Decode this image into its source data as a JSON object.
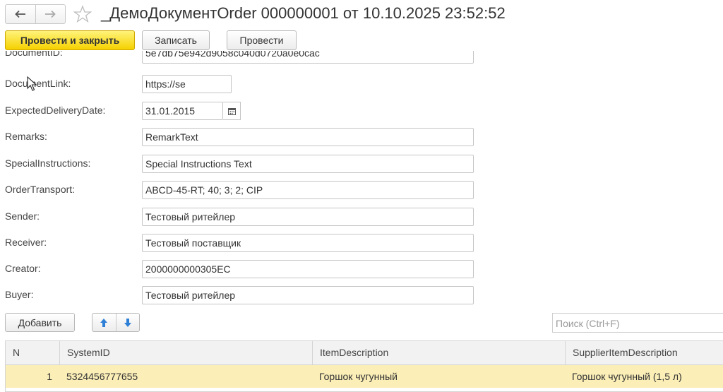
{
  "window": {
    "title": "_ДемоДокументOrder 000000001 от 10.10.2025 23:52:52"
  },
  "toolbar": {
    "post_close_label": "Провести и закрыть",
    "save_label": "Записать",
    "post_label": "Провести"
  },
  "fields": [
    {
      "label": "DocumentID:",
      "value": "5e7db75e942d9058c040d0720a0e0cac"
    },
    {
      "label": "DocumentLink:",
      "value": "https://se"
    },
    {
      "label": "ExpectedDeliveryDate:",
      "value": "31.01.2015"
    },
    {
      "label": "Remarks:",
      "value": "RemarkText"
    },
    {
      "label": "SpecialInstructions:",
      "value": "Special Instructions Text"
    },
    {
      "label": "OrderTransport:",
      "value": "ABCD-45-RT; 40; 3; 2; CIP"
    },
    {
      "label": "Sender:",
      "value": "Тестовый ритейлер"
    },
    {
      "label": "Receiver:",
      "value": "Тестовый поставщик"
    },
    {
      "label": "Creator:",
      "value": "2000000000305EC"
    },
    {
      "label": "Buyer:",
      "value": "Тестовый ритейлер"
    }
  ],
  "table_toolbar": {
    "add_label": "Добавить",
    "search_placeholder": "Поиск (Ctrl+F)"
  },
  "table": {
    "columns": [
      "N",
      "SystemID",
      "ItemDescription",
      "SupplierItemDescription"
    ],
    "rows": [
      [
        "1",
        "5324456777655",
        "Горшок чугунный",
        "Горшок чугунный (1,5 л)"
      ]
    ]
  },
  "colors": {
    "primary_button": "#f5d100",
    "selected_row": "#fbeeb7",
    "header_bg": "#f2f2f2"
  },
  "icons": [
    "back-arrow-icon",
    "forward-arrow-icon",
    "favorite-star-icon",
    "calendar-icon",
    "move-up-icon",
    "move-down-icon",
    "mouse-cursor-icon"
  ]
}
